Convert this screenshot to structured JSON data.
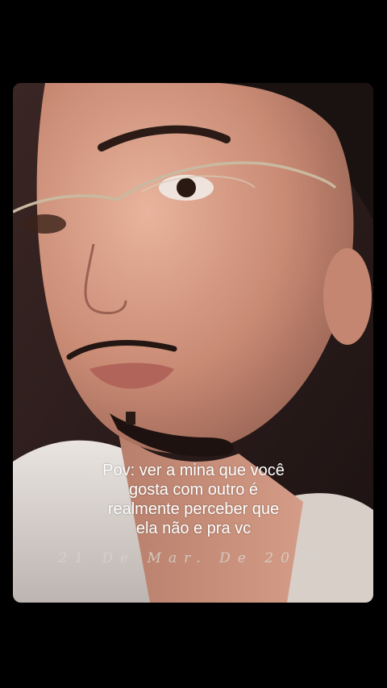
{
  "caption": {
    "line1": "Pov:  ver a mina que você",
    "line2": "gosta com outro é",
    "line3": "realmente perceber que",
    "line4": "ela não e pra vc"
  },
  "date_stamp": "21 De Mar. De 2026",
  "colors": {
    "background": "#000000",
    "caption_text": "#ffffff",
    "date_text": "#d8d2cc"
  }
}
